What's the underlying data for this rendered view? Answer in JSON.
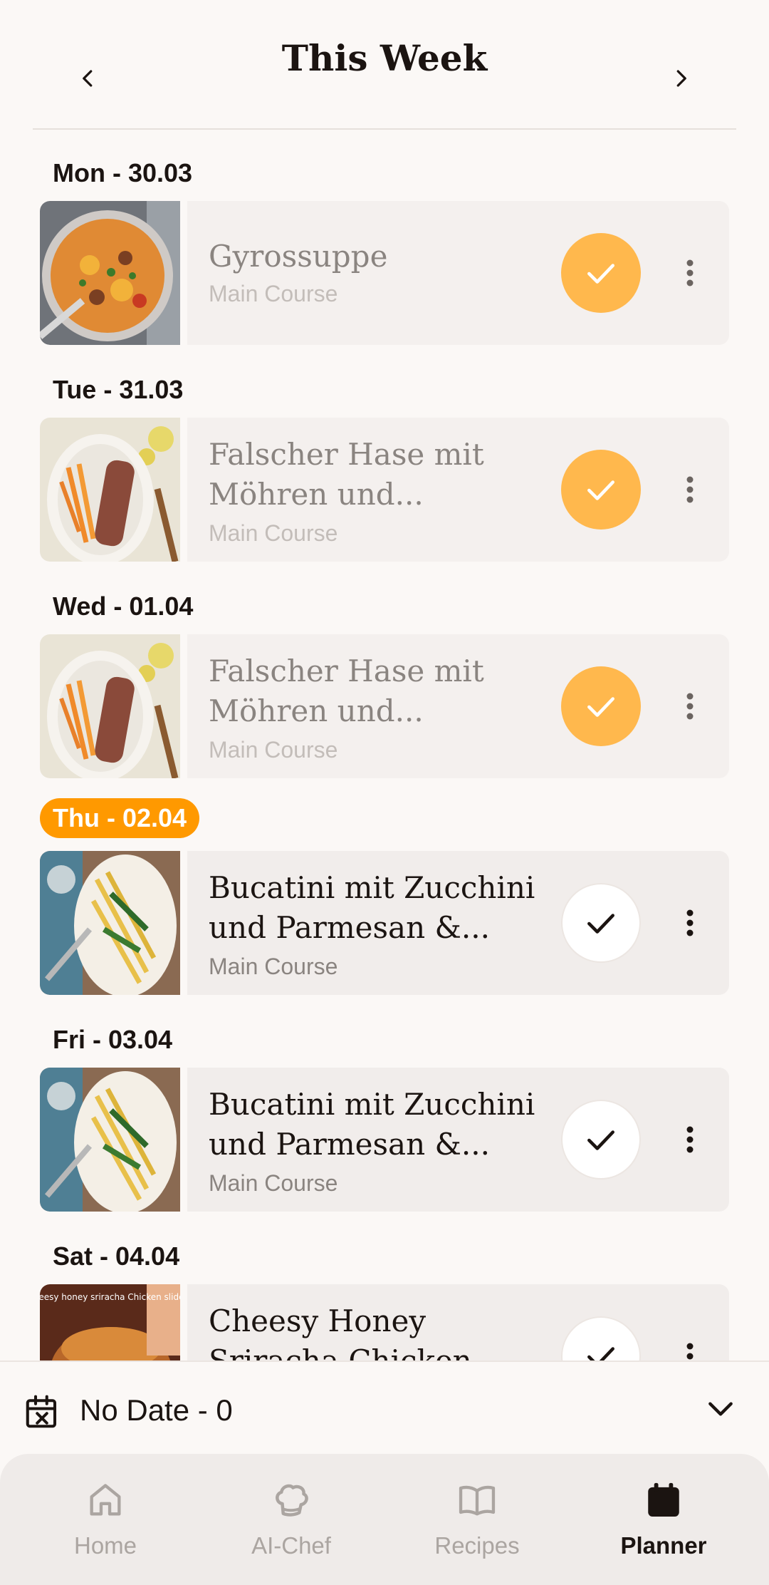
{
  "header": {
    "title": "This Week",
    "prev_icon": "chevron-left-icon",
    "next_icon": "chevron-right-icon"
  },
  "days": [
    {
      "label": "Mon - 30.03",
      "today": false,
      "meal": {
        "title_line1": "Gyrossuppe",
        "title_line2": "",
        "category": "Main Course",
        "cooked": true
      }
    },
    {
      "label": "Tue - 31.03",
      "today": false,
      "meal": {
        "title_line1": "Falscher Hase mit",
        "title_line2": "Möhren und...",
        "category": "Main Course",
        "cooked": true
      }
    },
    {
      "label": "Wed - 01.04",
      "today": false,
      "meal": {
        "title_line1": "Falscher Hase mit",
        "title_line2": "Möhren und...",
        "category": "Main Course",
        "cooked": true
      }
    },
    {
      "label": "Thu - 02.04",
      "today": true,
      "meal": {
        "title_line1": "Bucatini mit Zucchini",
        "title_line2": "und Parmesan &...",
        "category": "Main Course",
        "cooked": false
      }
    },
    {
      "label": "Fri - 03.04",
      "today": false,
      "meal": {
        "title_line1": "Bucatini mit Zucchini",
        "title_line2": "und Parmesan &...",
        "category": "Main Course",
        "cooked": false
      }
    },
    {
      "label": "Sat - 04.04",
      "today": false,
      "meal": {
        "title_line1": "Cheesy Honey",
        "title_line2": "Sriracha Chicken",
        "category": "",
        "cooked": false,
        "thumb_text": "Cheesy honey sriracha Chicken sliders"
      }
    }
  ],
  "no_date": {
    "label": "No Date - 0"
  },
  "bottom_nav": {
    "items": [
      {
        "label": "Home",
        "icon": "home-icon",
        "active": false
      },
      {
        "label": "AI-Chef",
        "icon": "chef-hat-icon",
        "active": false
      },
      {
        "label": "Recipes",
        "icon": "book-icon",
        "active": false
      },
      {
        "label": "Planner",
        "icon": "calendar-icon",
        "active": true
      }
    ]
  },
  "colors": {
    "accent": "#ff9900",
    "check_done": "#ffb84d",
    "background": "#fbf8f6",
    "card": "#f1edeb"
  }
}
